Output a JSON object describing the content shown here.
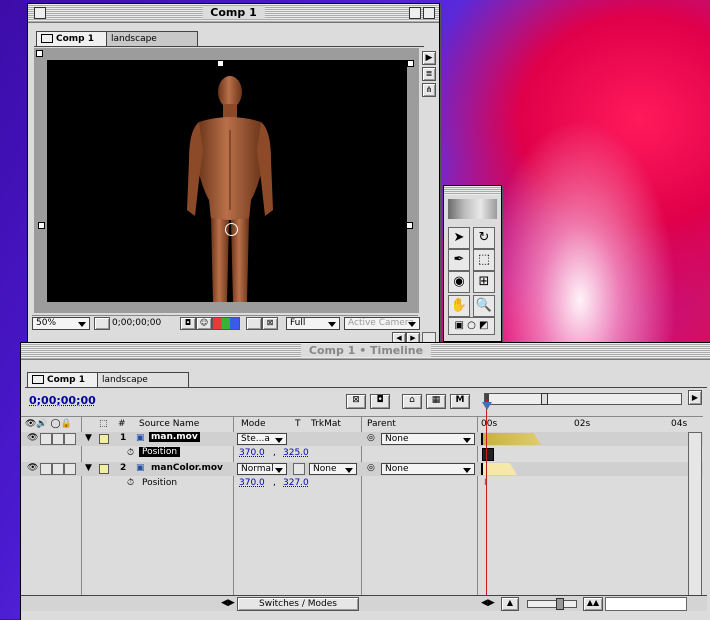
{
  "comp_window": {
    "title": "Comp 1",
    "tabs": [
      {
        "label": "Comp 1"
      },
      {
        "label": "landscape"
      }
    ],
    "bottom": {
      "zoom": "50%",
      "timecode": "0;00;00;00",
      "resolution": "Full",
      "camera": "Active Camera"
    }
  },
  "timeline_window": {
    "title": "Comp 1 • Timeline",
    "tabs": [
      {
        "label": "Comp 1"
      },
      {
        "label": "landscape"
      }
    ],
    "timecode": "0;00;00;00",
    "columns": {
      "source_name": "Source Name",
      "mode": "Mode",
      "t": "T",
      "trkmat": "TrkMat",
      "parent": "Parent",
      "number": "#"
    },
    "ruler": {
      "t0": "00s",
      "t1": "02s",
      "t2": "04s"
    },
    "layers": [
      {
        "index": "1",
        "name": "man.mov",
        "mode": "Ste...a",
        "trkmat": "",
        "parent": "None",
        "property": "Position",
        "value_x": "370.0",
        "value_y": "325.0",
        "value_sep": ","
      },
      {
        "index": "2",
        "name": "manColor.mov",
        "mode": "Normal",
        "trkmat": "None",
        "parent": "None",
        "property": "Position",
        "value_x": "370.0",
        "value_y": "327.0",
        "value_sep": ","
      }
    ],
    "switches_label": "Switches / Modes"
  },
  "tools_palette": {
    "tools": [
      "selection-tool",
      "rotation-tool",
      "pen-tool",
      "mask-tool",
      "orbit-camera-tool",
      "track-xy-tool",
      "hand-tool",
      "zoom-tool"
    ]
  }
}
